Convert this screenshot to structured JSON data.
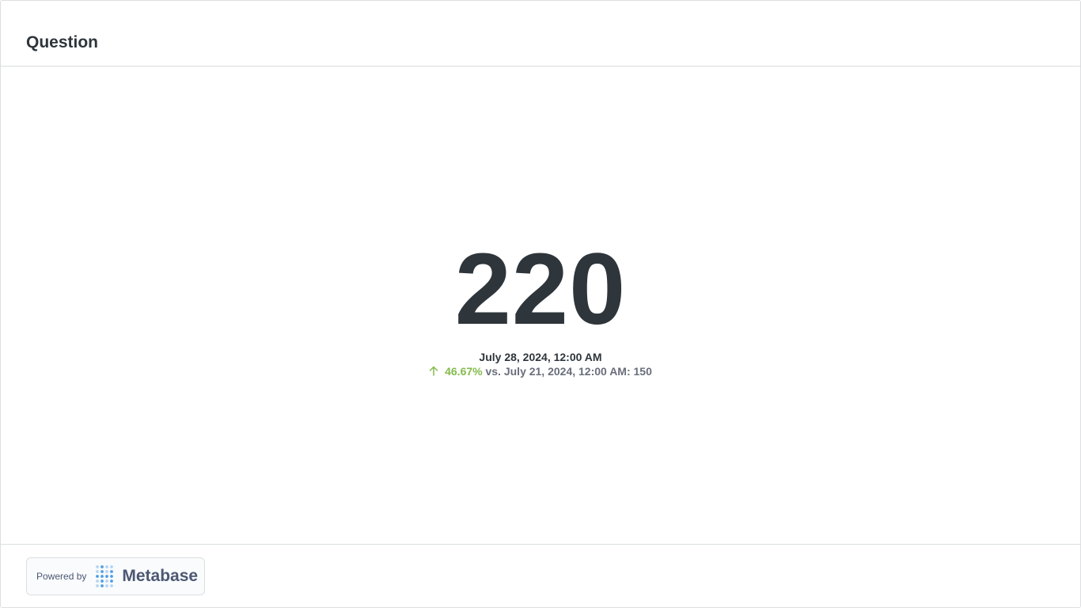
{
  "header": {
    "title": "Question"
  },
  "scalar": {
    "value": "220",
    "date": "July 28, 2024, 12:00 AM",
    "change_percent": "46.67%",
    "change_direction": "up",
    "comparison_text": " vs. July 21, 2024, 12:00 AM: 150"
  },
  "footer": {
    "powered_by": "Powered by",
    "brand": "Metabase",
    "logo_icon": "metabase-logo-icon"
  },
  "colors": {
    "text": "#2e353b",
    "muted": "#696e7b",
    "positive": "#84bb4c",
    "brand_blue": "#509ee3",
    "border": "#dcdfe0"
  }
}
